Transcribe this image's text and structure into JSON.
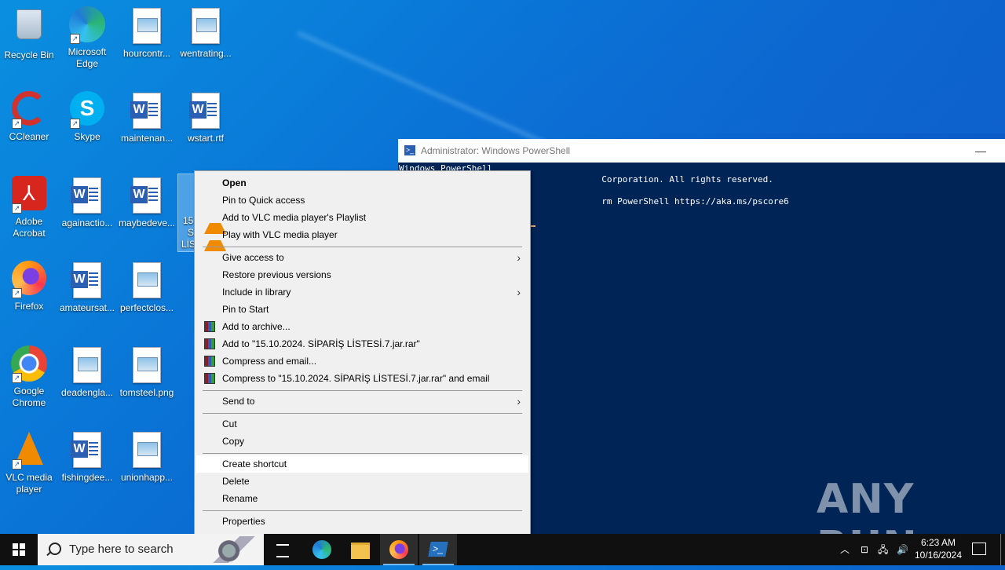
{
  "desktop": {
    "icons": [
      {
        "label": "Recycle Bin"
      },
      {
        "label": "Microsoft Edge"
      },
      {
        "label": "hourcontr..."
      },
      {
        "label": "wentrating..."
      },
      {
        "label": "CCleaner"
      },
      {
        "label": "Skype"
      },
      {
        "label": "maintenan..."
      },
      {
        "label": "wstart.rtf"
      },
      {
        "label": "Adobe Acrobat"
      },
      {
        "label": "againactio..."
      },
      {
        "label": "maybedeve..."
      },
      {
        "label": "Firefox"
      },
      {
        "label": "amateursat..."
      },
      {
        "label": "perfectclos..."
      },
      {
        "label": "Google Chrome"
      },
      {
        "label": "deadengla..."
      },
      {
        "label": "tomsteel.png"
      },
      {
        "label": "VLC media player"
      },
      {
        "label": "fishingdee..."
      },
      {
        "label": "unionhapp..."
      }
    ],
    "selected_partial": {
      "line1": "15.",
      "line2": "S",
      "line3": "LİS"
    }
  },
  "powershell": {
    "title": "Administrator: Windows PowerShell",
    "lines": [
      "Windows PowerShell",
      "                                       Corporation. All rights reserved.",
      "",
      "                                       rm PowerShell https://aka.ms/pscore6"
    ]
  },
  "context_menu": {
    "open": "Open",
    "pin_quick": "Pin to Quick access",
    "vlc_playlist": "Add to VLC media player's Playlist",
    "vlc_play": "Play with VLC media player",
    "give_access": "Give access to",
    "restore": "Restore previous versions",
    "include_library": "Include in library",
    "pin_start": "Pin to Start",
    "add_archive": "Add to archive...",
    "add_to_rar": "Add to \"15.10.2024. SİPARİŞ LİSTESİ.7.jar.rar\"",
    "compress_email": "Compress and email...",
    "compress_to_rar_email": "Compress to \"15.10.2024. SİPARİŞ LİSTESİ.7.jar.rar\" and email",
    "send_to": "Send to",
    "cut": "Cut",
    "copy": "Copy",
    "create_shortcut": "Create shortcut",
    "delete": "Delete",
    "rename": "Rename",
    "properties": "Properties"
  },
  "taskbar": {
    "search_placeholder": "Type here to search",
    "time": "6:23 AM",
    "date": "10/16/2024"
  },
  "watermark": "ANY RUN"
}
